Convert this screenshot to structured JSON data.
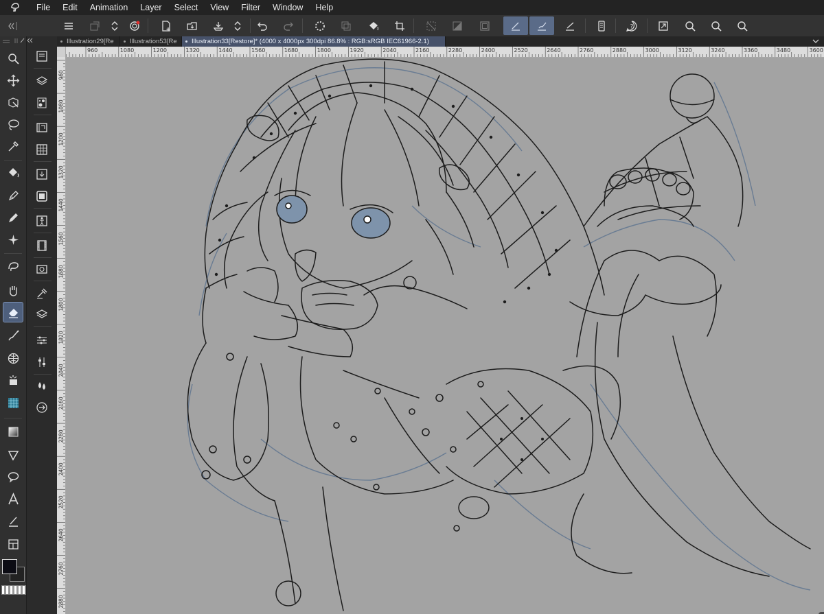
{
  "menu": {
    "items": [
      "File",
      "Edit",
      "Animation",
      "Layer",
      "Select",
      "View",
      "Filter",
      "Window",
      "Help"
    ]
  },
  "toolbar": {
    "icons": [
      "menu-icon",
      "new-layer-icon",
      "resize-icon",
      "spiral-icon",
      "new-file-icon",
      "open-icon",
      "save-icon",
      "stepper-icon",
      "undo-icon",
      "redo-icon",
      "loading-icon",
      "layer-merge-icon",
      "fill-icon",
      "crop-icon",
      "deselect-icon",
      "invert-icon",
      "selection-icon",
      "stabilizer-icon",
      "brush-icon",
      "ruler-pen-icon",
      "device-icon",
      "help-icon",
      "fit-icon",
      "zoom-in-icon",
      "zoom-out-icon",
      "zoom-icon"
    ]
  },
  "tabs": [
    {
      "label": "Illustration29[Re",
      "active": false
    },
    {
      "label": "Illustration53[Re",
      "active": false
    },
    {
      "label": "Illustration33[Restore]* (4000 x 4000px 300dpi 86.8% : RGB:sRGB IEC61966-2.1)",
      "active": true
    }
  ],
  "ruler_top": [
    "960",
    "1080",
    "1200",
    "1320",
    "1440",
    "1560",
    "1680",
    "1800",
    "1920",
    "2040",
    "2160",
    "2280",
    "2400",
    "2520",
    "2640",
    "2760",
    "2880",
    "3000",
    "3120",
    "3240",
    "3360",
    "3480",
    "3600"
  ],
  "ruler_left": [
    "960",
    "1080",
    "1200",
    "1320",
    "1440",
    "1560",
    "1680",
    "1800",
    "1920",
    "2040",
    "2160",
    "2280",
    "2400",
    "2520",
    "2640",
    "2760",
    "2880"
  ],
  "tools": [
    "magnifier-icon",
    "move-icon",
    "transform-icon",
    "lasso-icon",
    "eyedropper-icon",
    "fill-bucket-icon",
    "pen-icon",
    "pencil-icon",
    "sparkle-icon",
    "blend-icon",
    "hand-icon",
    "eraser-icon",
    "brush-tool-icon",
    "grid-tool-icon",
    "dot-tool-icon",
    "teal-grid-icon",
    "gradient-icon",
    "figure-icon",
    "balloon-icon",
    "text-icon",
    "ruler-line-icon",
    "panel-icon"
  ],
  "colors": {
    "accent": "#5a6b88",
    "canvas": "#a3a3a3",
    "foreground": "#0c0c14",
    "line": "#1c1c1c",
    "blue_line": "#5f7590",
    "eye": "#7e93ab"
  }
}
